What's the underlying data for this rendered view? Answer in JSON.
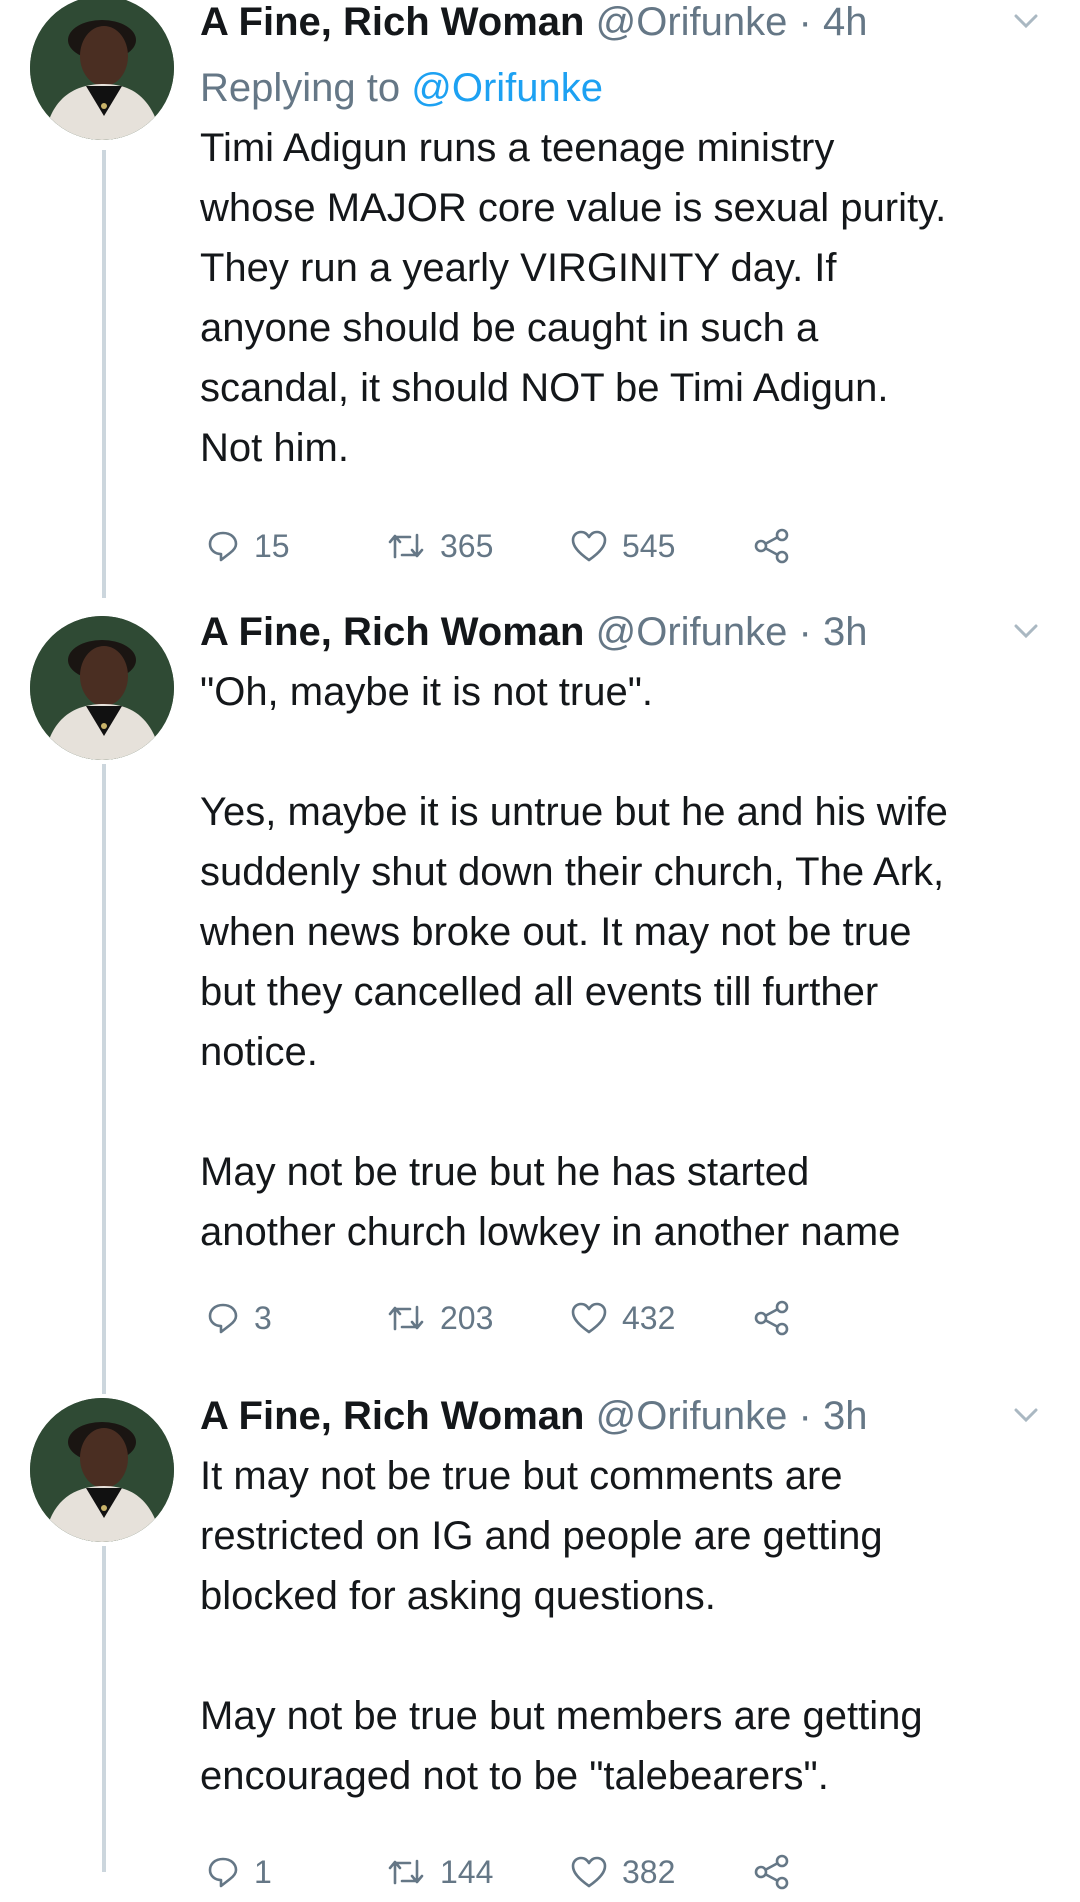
{
  "colors": {
    "text": "#14171a",
    "muted": "#657786",
    "link": "#1da1f2",
    "thread_line": "#ccd6dd"
  },
  "tweets": [
    {
      "name": "A Fine, Rich Woman",
      "handle": "@Orifunke",
      "dot": "·",
      "time": "4h",
      "replying_prefix": "Replying to",
      "replying_to": "@Orifunke",
      "paragraphs": [
        "Timi Adigun runs a teenage ministry",
        "whose MAJOR core value is sexual purity.",
        "They run a yearly VIRGINITY day. If",
        "anyone should be caught in such a",
        "scandal, it should NOT be Timi Adigun.",
        "Not him."
      ],
      "replies": "15",
      "retweets": "365",
      "likes": "545",
      "icons": [
        "reply-icon",
        "retweet-icon",
        "like-icon",
        "share-icon",
        "chevron-down-icon"
      ]
    },
    {
      "name": "A Fine, Rich Woman",
      "handle": "@Orifunke",
      "dot": "·",
      "time": "3h",
      "paragraphs": [
        "\"Oh, maybe it is not true\".",
        "",
        "Yes, maybe it is untrue but he and his wife",
        "suddenly shut down their church, The Ark,",
        "when news broke out. It may not be true",
        "but they cancelled all events till further",
        "notice.",
        "",
        "May not be true but he has started",
        "another church lowkey in another name"
      ],
      "replies": "3",
      "retweets": "203",
      "likes": "432"
    },
    {
      "name": "A Fine, Rich Woman",
      "handle": "@Orifunke",
      "dot": "·",
      "time": "3h",
      "paragraphs": [
        "It may not be true but comments are",
        "restricted on IG and people are getting",
        "blocked for asking questions.",
        "",
        "May not be true but members are getting",
        "encouraged not to be \"talebearers\"."
      ],
      "replies": "1",
      "retweets": "144",
      "likes": "382"
    }
  ]
}
